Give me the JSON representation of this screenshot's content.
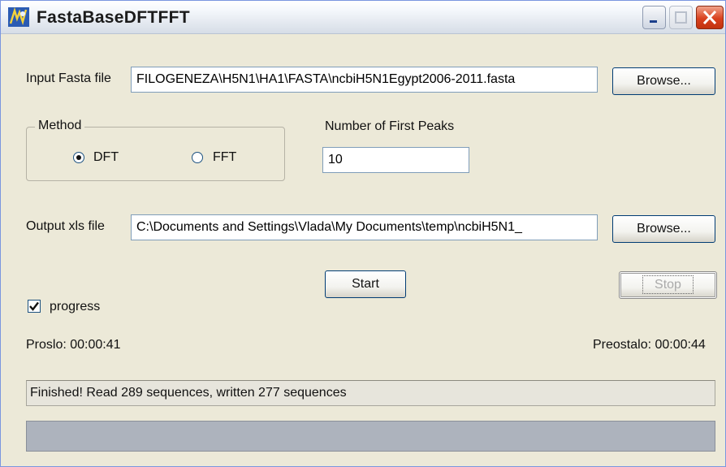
{
  "window": {
    "title": "FastaBaseDFTFFT"
  },
  "input": {
    "label": "Input Fasta file",
    "value": "FILOGENEZA\\H5N1\\HA1\\FASTA\\ncbiH5N1Egypt2006-2011.fasta",
    "browse_label": "Browse..."
  },
  "method": {
    "group_label": "Method",
    "options": [
      "DFT",
      "FFT"
    ],
    "selected": "DFT"
  },
  "peaks": {
    "label": "Number of First Peaks",
    "value": "10"
  },
  "output": {
    "label": "Output xls file",
    "value": "C:\\Documents and Settings\\Vlada\\My Documents\\temp\\ncbiH5N1_",
    "browse_label": "Browse..."
  },
  "actions": {
    "start_label": "Start",
    "stop_label": "Stop"
  },
  "progress_check": {
    "label": "progress",
    "checked": true
  },
  "times": {
    "elapsed": "Proslo: 00:00:41",
    "remaining": "Preostalo: 00:00:44"
  },
  "status": {
    "message": "Finished! Read 289 sequences, written 277 sequences"
  },
  "progress_bar": {
    "fraction": 0
  }
}
